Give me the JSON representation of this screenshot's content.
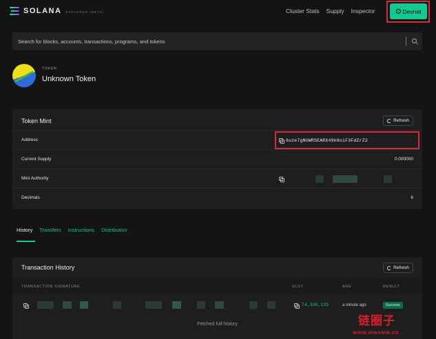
{
  "nav": {
    "logo_text": "SOLANA",
    "logo_sub": "EXPLORER (BETA)",
    "links": [
      "Cluster Stats",
      "Supply",
      "Inspector"
    ],
    "network_button": "Devnet",
    "accent": "#14c98f",
    "highlight": "#d72b3f"
  },
  "search": {
    "placeholder": "Search for blocks, accounts, transactions, programs, and tokens",
    "icon": "search-icon"
  },
  "token": {
    "label": "TOKEN",
    "name": "Unknown Token"
  },
  "mint": {
    "title": "Token Mint",
    "refresh_label": "Refresh",
    "rows": [
      {
        "label": "Address",
        "value": "6uze7gNUWRSEARX49k8oiF3FdZrZ2"
      },
      {
        "label": "Current Supply",
        "value": "0.000000"
      },
      {
        "label": "Mint Authority",
        "value": ""
      },
      {
        "label": "Decimals",
        "value": "6"
      }
    ]
  },
  "tabs": [
    "History",
    "Transfers",
    "Instructions",
    "Distribution"
  ],
  "history": {
    "title": "Transaction History",
    "refresh_label": "Refresh",
    "columns": [
      "TRANSACTION SIGNATURE",
      "SLOT",
      "AGE",
      "RESULT"
    ],
    "rows": [
      {
        "slot": "74,336,129",
        "age": "a minute ago",
        "result": "Success"
      }
    ],
    "footer": "Fetched full history"
  },
  "watermark": {
    "main": "链圈子",
    "url": "www.wwsww.cn"
  }
}
